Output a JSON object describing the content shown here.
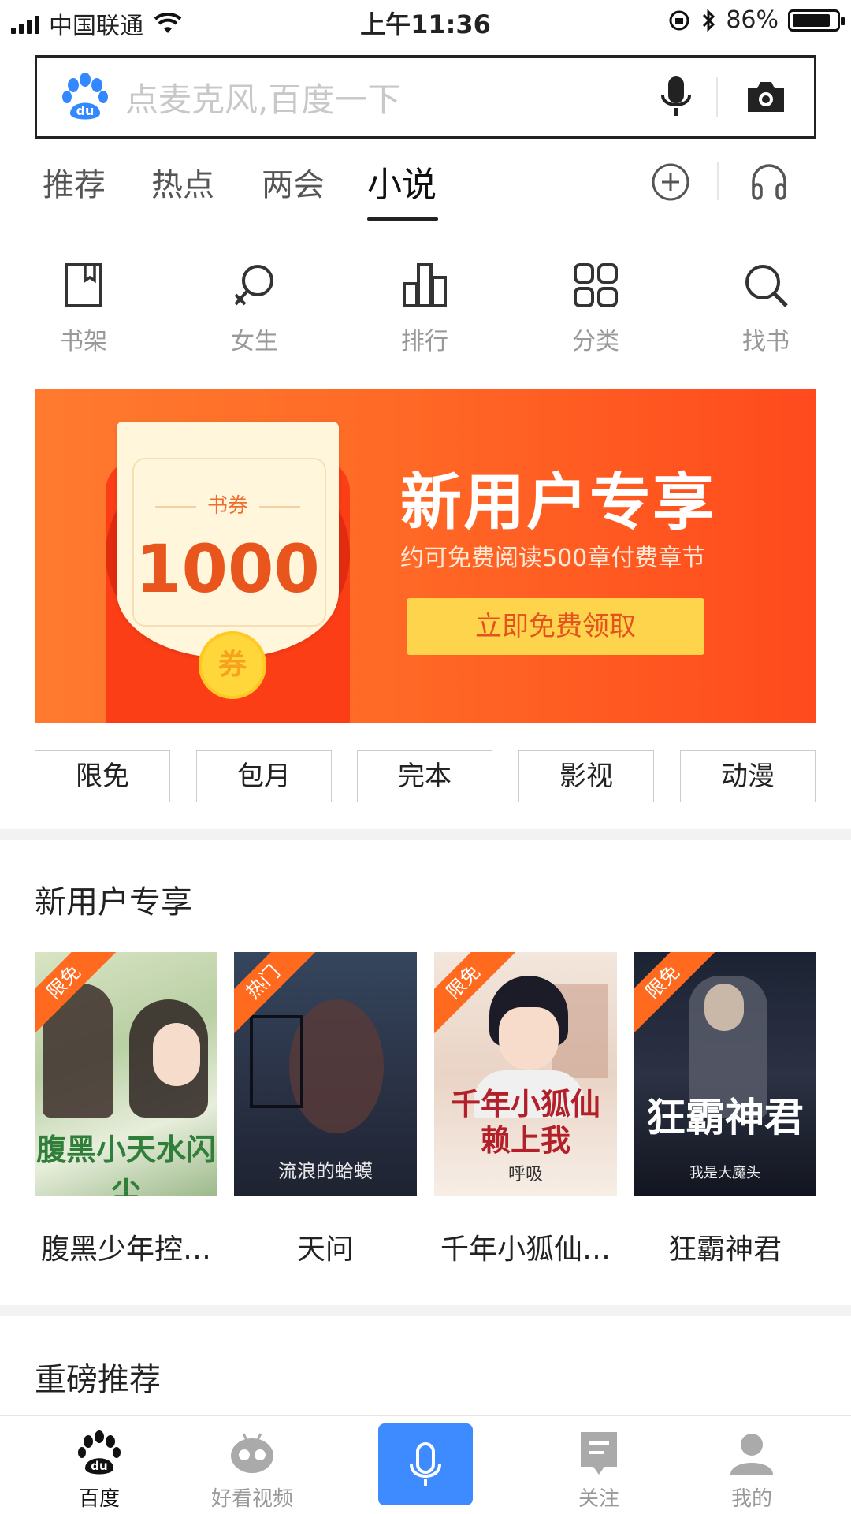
{
  "status_bar": {
    "carrier": "中国联通",
    "time": "上午11:36",
    "battery": "86%"
  },
  "search": {
    "placeholder": "点麦克风,百度一下"
  },
  "tabs": [
    {
      "label": "推荐"
    },
    {
      "label": "热点"
    },
    {
      "label": "两会"
    },
    {
      "label": "小说",
      "active": true
    }
  ],
  "categories": [
    {
      "label": "书架",
      "icon": "bookshelf-icon"
    },
    {
      "label": "女生",
      "icon": "female-icon"
    },
    {
      "label": "排行",
      "icon": "ranking-icon"
    },
    {
      "label": "分类",
      "icon": "category-grid-icon"
    },
    {
      "label": "找书",
      "icon": "search-icon"
    }
  ],
  "banner": {
    "ticket_label": "书券",
    "ticket_value": "1000",
    "coin_text": "券",
    "title": "新用户专享",
    "subtitle": "约可免费阅读500章付费章节",
    "button": "立即免费领取"
  },
  "filters": [
    "限免",
    "包月",
    "完本",
    "影视",
    "动漫"
  ],
  "section1": {
    "title": "新用户专享"
  },
  "books": [
    {
      "tag": "限免",
      "title": "腹黑少年控…",
      "cover_text": "腹黑小天水闪尘"
    },
    {
      "tag": "热门",
      "title": "天问",
      "cover_text": "流浪的蛤蟆"
    },
    {
      "tag": "限免",
      "title": "千年小狐仙…",
      "cover_text": "千年小狐仙赖上我",
      "cover_author": "呼吸"
    },
    {
      "tag": "限免",
      "title": "狂霸神君",
      "cover_text": "狂霸神君",
      "cover_author": "我是大魔头"
    }
  ],
  "section2": {
    "title": "重磅推荐"
  },
  "bottom_nav": [
    {
      "label": "百度",
      "active": true
    },
    {
      "label": "好看视频"
    },
    {
      "label": ""
    },
    {
      "label": "关注"
    },
    {
      "label": "我的"
    }
  ],
  "colors": {
    "accent": "#3d8bff",
    "banner_orange": "#ff6a26",
    "button_yellow": "#ffd44d",
    "ribbon": "#ff6a1f"
  }
}
